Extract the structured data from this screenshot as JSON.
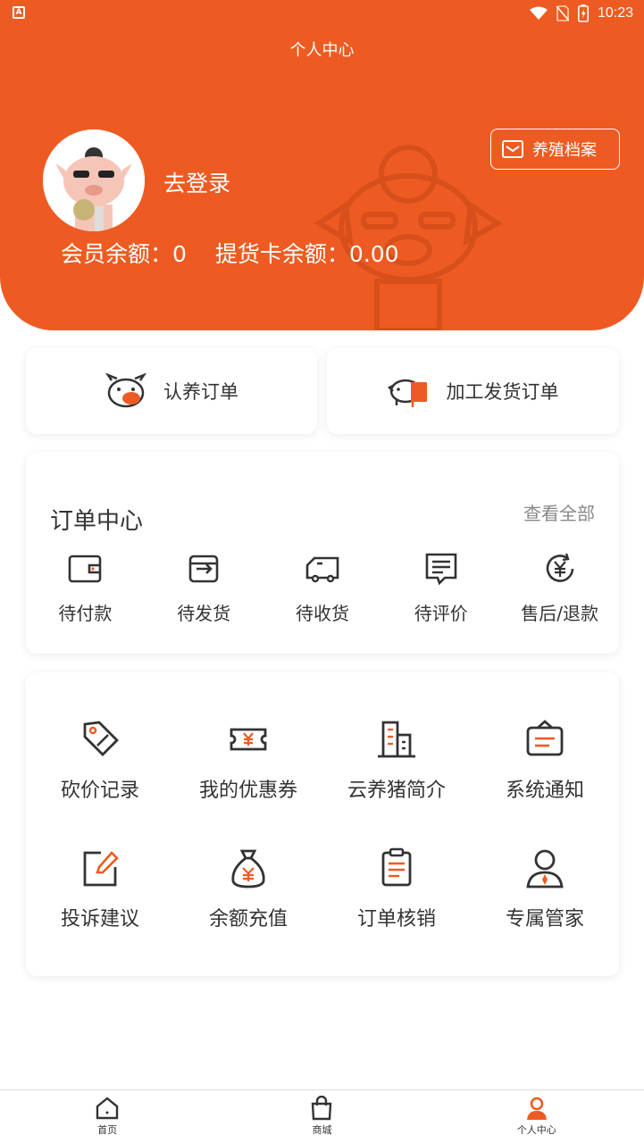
{
  "status_bar": {
    "time": "10:23"
  },
  "header": {
    "title": "个人中心",
    "login_label": "去登录",
    "archive_button": "养殖档案",
    "member_balance": "会员余额：0",
    "card_balance": "提货卡余额：0.00"
  },
  "quick_actions": [
    {
      "label": "认养订单",
      "icon": "pig-face-icon"
    },
    {
      "label": "加工发货订单",
      "icon": "pig-truck-icon"
    }
  ],
  "orders": {
    "title": "订单中心",
    "view_all": "查看全部",
    "items": [
      {
        "label": "待付款",
        "icon": "wallet-icon"
      },
      {
        "label": "待发货",
        "icon": "box-out-icon"
      },
      {
        "label": "待收货",
        "icon": "truck-icon"
      },
      {
        "label": "待评价",
        "icon": "comment-icon"
      },
      {
        "label": "售后/退款",
        "icon": "refund-yen-icon"
      }
    ]
  },
  "services": [
    {
      "label": "砍价记录",
      "icon": "discount-tag-icon"
    },
    {
      "label": "我的优惠券",
      "icon": "coupon-icon"
    },
    {
      "label": "云养猪简介",
      "icon": "building-icon"
    },
    {
      "label": "系统通知",
      "icon": "notice-bag-icon"
    },
    {
      "label": "投诉建议",
      "icon": "edit-icon"
    },
    {
      "label": "余额充值",
      "icon": "money-bag-icon"
    },
    {
      "label": "订单核销",
      "icon": "clipboard-icon"
    },
    {
      "label": "专属管家",
      "icon": "butler-icon"
    }
  ],
  "bottom_nav": [
    {
      "label": "首页",
      "icon": "home-icon"
    },
    {
      "label": "商城",
      "icon": "shopping-bag-icon"
    },
    {
      "label": "个人中心",
      "icon": "user-icon",
      "active": true
    }
  ],
  "colors": {
    "brand": "#ED5B22",
    "text": "#333333",
    "muted": "#888888"
  }
}
